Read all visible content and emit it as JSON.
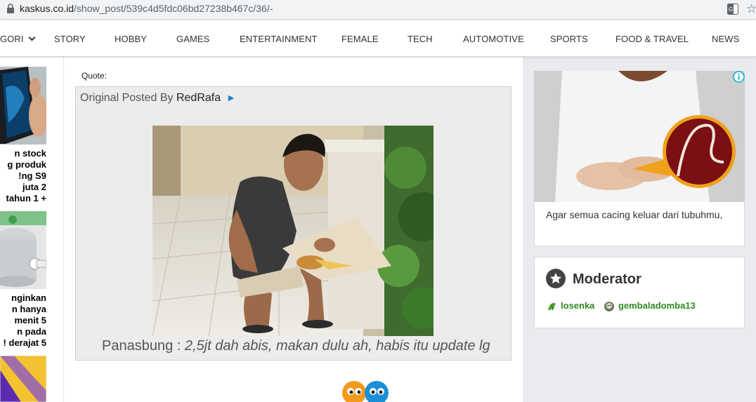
{
  "browser": {
    "url_host": "kaskus.co.id",
    "url_path": "/show_post/539c4d5fdc06bd27238b467c/36/-"
  },
  "nav": {
    "items": [
      "GORI",
      "STORY",
      "HOBBY",
      "GAMES",
      "ENTERTAINMENT",
      "FEMALE",
      "TECH",
      "AUTOMOTIVE",
      "SPORTS",
      "FOOD & TRAVEL",
      "NEWS"
    ]
  },
  "sidebar": {
    "items": [
      {
        "lines": [
          "n stock",
          "g produk",
          "ng S9!",
          "2 juta",
          "+ 1 tahun"
        ]
      },
      {
        "lines": [
          "nginkan",
          "n hanya",
          "5 menit",
          "n pada",
          "5 derajat !"
        ]
      }
    ]
  },
  "post": {
    "quote_label": "Quote:",
    "original_posted_by": "Original Posted By",
    "username": "RedRafa",
    "arrow": "►",
    "caption_prefix": "Panasbung : ",
    "caption_text": "2,5jt dah abis, makan dulu ah, habis itu update lg"
  },
  "ad": {
    "text": "Agar semua cacing keluar dari tubuhmu,"
  },
  "moderator": {
    "title": "Moderator",
    "users": [
      "losenka",
      "gembaladomba13"
    ]
  },
  "colors": {
    "accent_blue": "#1c7fd0",
    "moderator_green": "#2e8b1e",
    "page_bg": "#e9ebee"
  }
}
